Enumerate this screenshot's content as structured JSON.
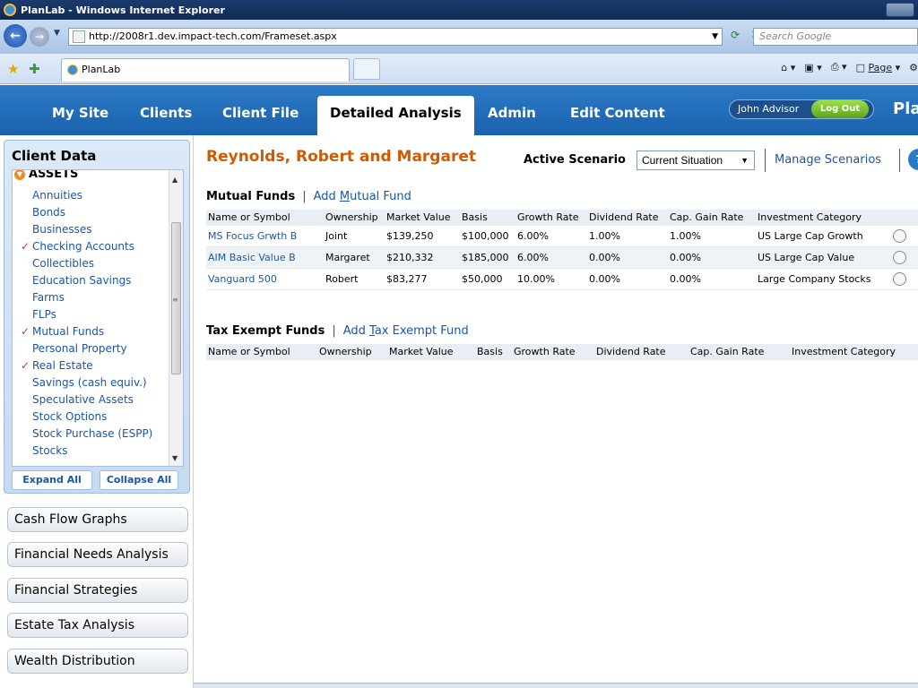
{
  "browser": {
    "window_title": "PlanLab - Windows Internet Explorer",
    "url": "http://2008r1.dev.impact-tech.com/Frameset.aspx",
    "search_placeholder": "Search Google",
    "tab_label": "PlanLab",
    "page_menu": "Page"
  },
  "nav": {
    "items": [
      "My Site",
      "Clients",
      "Client File",
      "Detailed Analysis",
      "Admin",
      "Edit Content"
    ],
    "active": "Detailed Analysis",
    "user": "John Advisor",
    "logout": "Log Out",
    "brand": "Pla"
  },
  "sidebar": {
    "title": "Client Data",
    "section": "Assets",
    "items": [
      {
        "label": "Annuities",
        "checked": false
      },
      {
        "label": "Bonds",
        "checked": false
      },
      {
        "label": "Businesses",
        "checked": false
      },
      {
        "label": "Checking Accounts",
        "checked": true
      },
      {
        "label": "Collectibles",
        "checked": false
      },
      {
        "label": "Education Savings",
        "checked": false
      },
      {
        "label": "Farms",
        "checked": false
      },
      {
        "label": "FLPs",
        "checked": false
      },
      {
        "label": "Mutual Funds",
        "checked": true
      },
      {
        "label": "Personal Property",
        "checked": false
      },
      {
        "label": "Real Estate",
        "checked": true
      },
      {
        "label": "Savings (cash equiv.)",
        "checked": false
      },
      {
        "label": "Speculative Assets",
        "checked": false
      },
      {
        "label": "Stock Options",
        "checked": false
      },
      {
        "label": "Stock Purchase (ESPP)",
        "checked": false
      },
      {
        "label": "Stocks",
        "checked": false
      }
    ],
    "expand_all": "Expand All",
    "collapse_all": "Collapse All",
    "accordion": [
      "Cash Flow Graphs",
      "Financial Needs Analysis",
      "Financial Strategies",
      "Estate Tax Analysis",
      "Wealth Distribution"
    ]
  },
  "main": {
    "client_name": "Reynolds, Robert and Margaret",
    "scenario_label": "Active Scenario",
    "scenario_value": "Current Situation",
    "manage_scenarios": "Manage Scenarios",
    "mutual_funds": {
      "title": "Mutual Funds",
      "add_prefix": "Add ",
      "add_underlined": "M",
      "add_suffix": "utual Fund",
      "columns": [
        "Name or Symbol",
        "Ownership",
        "Market Value",
        "Basis",
        "Growth Rate",
        "Dividend Rate",
        "Cap. Gain Rate",
        "Investment Category"
      ],
      "rows": [
        [
          "MS Focus Grwth B",
          "Joint",
          "$139,250",
          "$100,000",
          "6.00%",
          "1.00%",
          "1.00%",
          "US Large Cap Growth"
        ],
        [
          "AIM Basic Value B",
          "Margaret",
          "$210,332",
          "$185,000",
          "6.00%",
          "0.00%",
          "0.00%",
          "US Large Cap Value"
        ],
        [
          "Vanguard 500",
          "Robert",
          "$83,277",
          "$50,000",
          "10.00%",
          "0.00%",
          "0.00%",
          "Large Company Stocks"
        ]
      ]
    },
    "tax_exempt": {
      "title": "Tax Exempt Funds",
      "add_prefix": "Add ",
      "add_underlined": "T",
      "add_suffix": "ax Exempt Fund",
      "columns": [
        "Name or Symbol",
        "Ownership",
        "Market Value",
        "Basis",
        "Growth Rate",
        "Dividend Rate",
        "Cap. Gain Rate",
        "Investment Category"
      ]
    }
  }
}
